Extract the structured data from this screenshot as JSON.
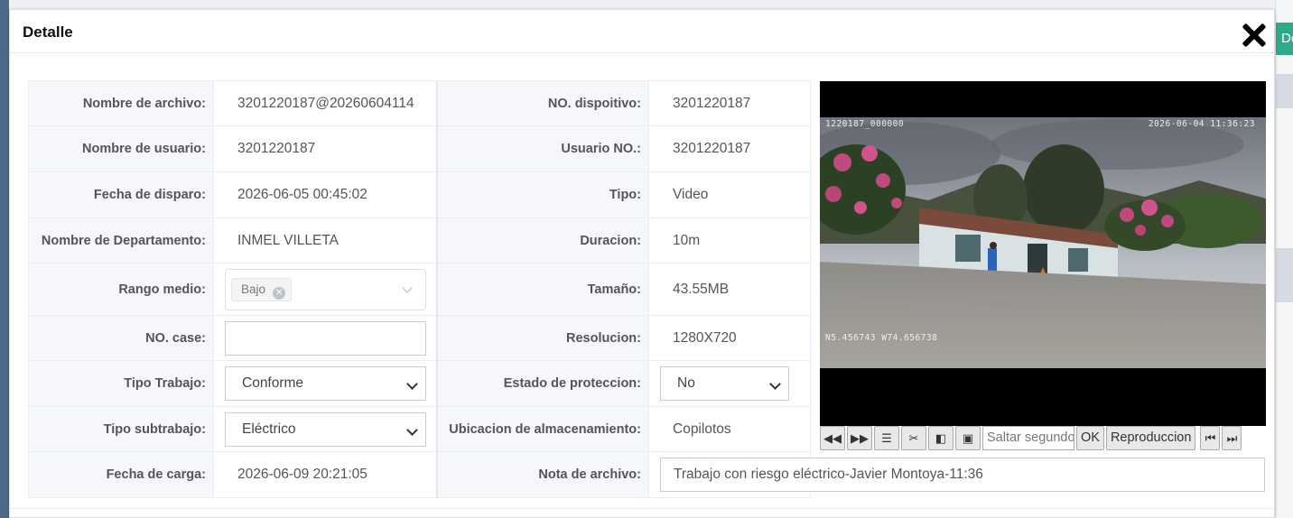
{
  "dialog": {
    "title": "Detalle",
    "background_button_label": "De"
  },
  "fields": {
    "nombre_archivo": {
      "label": "Nombre de archivo:",
      "value": "3201220187@20260604114"
    },
    "no_dispositivo": {
      "label": "NO. dispoitivo:",
      "value": "3201220187"
    },
    "nombre_usuario": {
      "label": "Nombre de usuario:",
      "value": "3201220187"
    },
    "usuario_no": {
      "label": "Usuario NO.:",
      "value": "3201220187"
    },
    "fecha_disparo": {
      "label": "Fecha de disparo:",
      "value": "2026-06-05 00:45:02"
    },
    "tipo": {
      "label": "Tipo:",
      "value": "Video"
    },
    "departamento": {
      "label": "Nombre de Departamento:",
      "value": "INMEL VILLETA"
    },
    "duracion": {
      "label": "Duracion:",
      "value": "10m"
    },
    "rango_medio": {
      "label": "Rango medio:",
      "tag": "Bajo"
    },
    "tamano": {
      "label": "Tamaño:",
      "value": "43.55MB"
    },
    "no_case": {
      "label": "NO. case:",
      "value": ""
    },
    "resolucion": {
      "label": "Resolucion:",
      "value": "1280X720"
    },
    "tipo_trabajo": {
      "label": "Tipo Trabajo:",
      "value": "Conforme"
    },
    "estado_proteccion": {
      "label": "Estado de proteccion:",
      "value": "No"
    },
    "tipo_subtrabajo": {
      "label": "Tipo subtrabajo:",
      "value": "Eléctrico"
    },
    "ubicacion": {
      "label": "Ubicacion de almacenamiento:",
      "value": "Copilotos"
    },
    "fecha_carga": {
      "label": "Fecha de carga:",
      "value": "2026-06-09 20:21:05"
    },
    "nota_archivo": {
      "label": "Nota de archivo:",
      "value": "Trabajo con riesgo eléctrico-Javier Montoya-11:36"
    }
  },
  "video": {
    "osd_top_left": "1220187_000000",
    "osd_top_right": "2026-06-04 11:36:23",
    "osd_bottom_left": "N5.456743  W74.656738"
  },
  "player_controls": {
    "seek_placeholder": "Saltar segundo",
    "ok_label": "OK",
    "play_label": "Reproduccion",
    "icons": [
      "rewind-icon",
      "fast-forward-icon",
      "list-icon",
      "scissors-icon",
      "frame-back-icon",
      "frame-forward-icon",
      "skip-start-icon",
      "skip-end-icon"
    ]
  },
  "colors": {
    "accent_green": "#2eaa8a",
    "label_bg": "#f5f7fa"
  }
}
